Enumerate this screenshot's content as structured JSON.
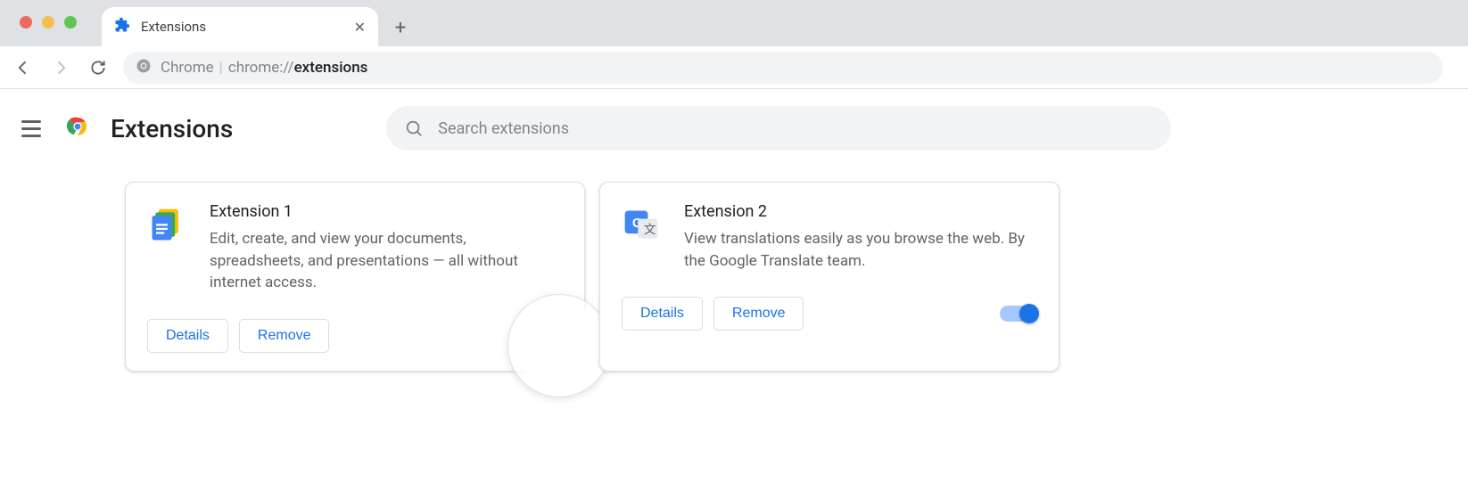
{
  "browser": {
    "tab_title": "Extensions",
    "url_label": "Chrome",
    "url_scheme": "chrome://",
    "url_path": "extensions"
  },
  "header": {
    "title": "Extensions",
    "search_placeholder": "Search extensions"
  },
  "buttons": {
    "details": "Details",
    "remove": "Remove"
  },
  "extensions": [
    {
      "name": "Extension 1",
      "description": "Edit, create, and view your documents, spreadsheets, and presentations — all without internet access.",
      "enabled": false,
      "icon": "docs"
    },
    {
      "name": "Extension 2",
      "description": "View translations easily as you browse the web. By the Google Translate team.",
      "enabled": true,
      "icon": "translate"
    }
  ]
}
